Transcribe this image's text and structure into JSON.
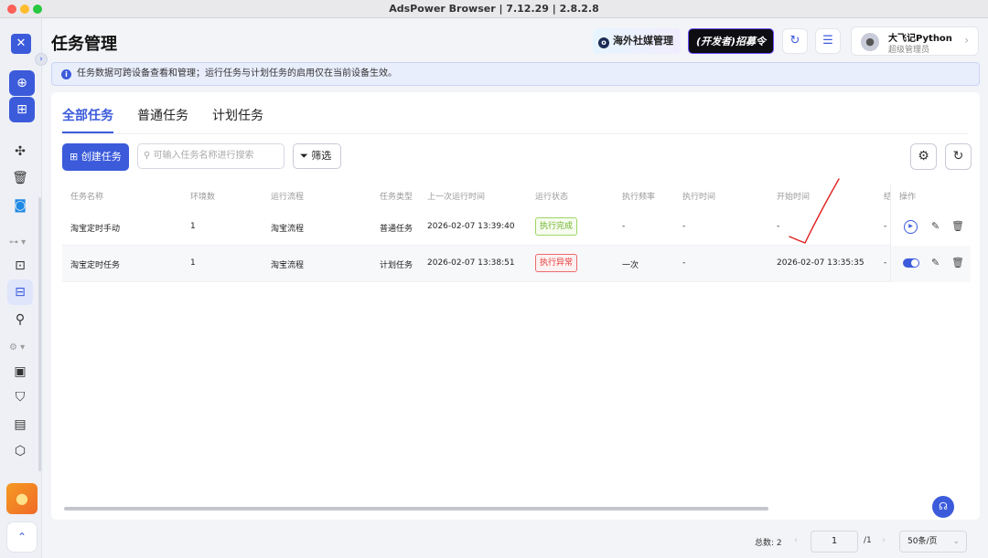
{
  "window": {
    "title": "AdsPower Browser | 7.12.29 | 2.8.2.8"
  },
  "sidebar": {
    "expand_icon": "chevron-right-icon",
    "items": [
      {
        "name": "new-profile",
        "icon": "plus-circle-icon"
      },
      {
        "name": "batch-import",
        "icon": "add-box-icon"
      },
      {
        "name": "extensions",
        "icon": "puzzle-icon"
      },
      {
        "name": "trash",
        "icon": "trash-icon"
      },
      {
        "name": "app-center",
        "icon": "app-icon"
      },
      {
        "name": "group",
        "icon": "group-icon"
      },
      {
        "name": "rpa-flow",
        "icon": "flowchart-icon"
      },
      {
        "name": "rpa-robot",
        "icon": "robot-icon",
        "active": true
      },
      {
        "name": "api",
        "icon": "plug-icon"
      },
      {
        "name": "settings-group",
        "icon": "gear-icon"
      },
      {
        "name": "billing",
        "icon": "wallet-icon"
      },
      {
        "name": "security",
        "icon": "shield-icon"
      },
      {
        "name": "logs",
        "icon": "clipboard-icon"
      },
      {
        "name": "more",
        "icon": "hexagon-icon"
      }
    ]
  },
  "header": {
    "title": "任务管理",
    "social_label": "海外社媒管理",
    "dev_label": "(开发者)招募令",
    "user_name": "大飞记Python",
    "user_role": "超级管理员"
  },
  "notice": {
    "text": "任务数据可跨设备查看和管理；运行任务与计划任务的启用仅在当前设备生效。"
  },
  "tabs": [
    {
      "label": "全部任务",
      "active": true
    },
    {
      "label": "普通任务",
      "active": false
    },
    {
      "label": "计划任务",
      "active": false
    }
  ],
  "toolbar": {
    "create_label": "创建任务",
    "search_placeholder": "可输入任务名称进行搜索",
    "filter_label": "筛选"
  },
  "table": {
    "columns": [
      "任务名称",
      "环境数",
      "运行流程",
      "任务类型",
      "上一次运行时间",
      "运行状态",
      "执行频率",
      "执行时间",
      "开始时间",
      "结",
      "操作"
    ],
    "rows": [
      {
        "name": "淘宝定时手动",
        "env": "1",
        "flow": "淘宝流程",
        "type": "普通任务",
        "last_run": "2026-02-07 13:39:40",
        "status": "执行完成",
        "status_kind": "ok",
        "freq": "-",
        "exec_time": "-",
        "start_time": "-",
        "end": "-"
      },
      {
        "name": "淘宝定时任务",
        "env": "1",
        "flow": "淘宝流程",
        "type": "计划任务",
        "last_run": "2026-02-07 13:38:51",
        "status": "执行异常",
        "status_kind": "error",
        "freq": "一次",
        "exec_time": "-",
        "start_time": "2026-02-07 13:35:35",
        "end": "-"
      }
    ]
  },
  "pagination": {
    "total": "总数: 2",
    "page": "1",
    "of": "/1",
    "page_size": "50条/页"
  },
  "colors": {
    "accent": "#3b5bdb",
    "success": "#6fb32e",
    "error": "#e33c3c",
    "annotation": "#e02020"
  }
}
